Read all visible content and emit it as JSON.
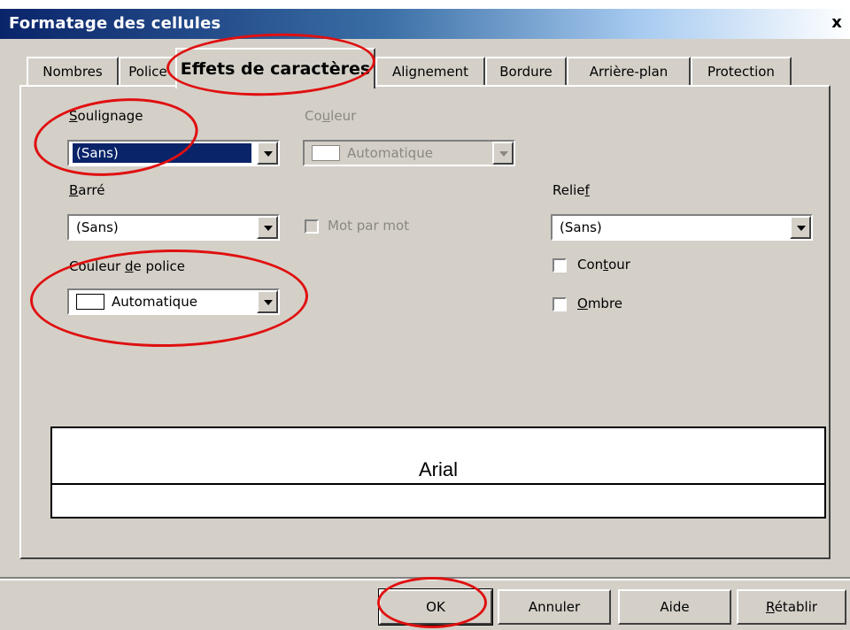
{
  "window": {
    "title": "Formatage des cellules",
    "close_label": "x"
  },
  "tabs": [
    {
      "label": "Nombres"
    },
    {
      "label": "Police"
    },
    {
      "label": "Effets de caractères",
      "active": true
    },
    {
      "label": "Alignement"
    },
    {
      "label": "Bordure"
    },
    {
      "label": "Arrière-plan"
    },
    {
      "label": "Protection"
    }
  ],
  "underline": {
    "label_key": "S",
    "label_rest": "oulignage",
    "value": "(Sans)"
  },
  "underline_color": {
    "label_pre": "Co",
    "label_key": "u",
    "label_rest": "leur",
    "value": "Automatique",
    "disabled": true
  },
  "strikethrough": {
    "label_key": "B",
    "label_rest": "arré",
    "value": "(Sans)"
  },
  "word_by_word": {
    "label": "Mot par mot",
    "disabled": true,
    "checked": false
  },
  "font_color": {
    "label_pre": "Couleur ",
    "label_key": "d",
    "label_rest": "e police",
    "value": "Automatique"
  },
  "relief": {
    "label_pre": "Relie",
    "label_key": "f",
    "value": "(Sans)"
  },
  "outline": {
    "label_pre": "Con",
    "label_key": "t",
    "label_rest": "our",
    "checked": false
  },
  "shadow": {
    "label_key": "O",
    "label_rest": "mbre",
    "checked": false
  },
  "preview": {
    "text": "Arial"
  },
  "buttons": {
    "ok": "OK",
    "cancel": "Annuler",
    "help": "Aide",
    "reset_key": "R",
    "reset_rest": "établir"
  },
  "colors": {
    "annotation": "#e01010",
    "selection": "#0a246a",
    "title_bar": "#0a246a"
  }
}
